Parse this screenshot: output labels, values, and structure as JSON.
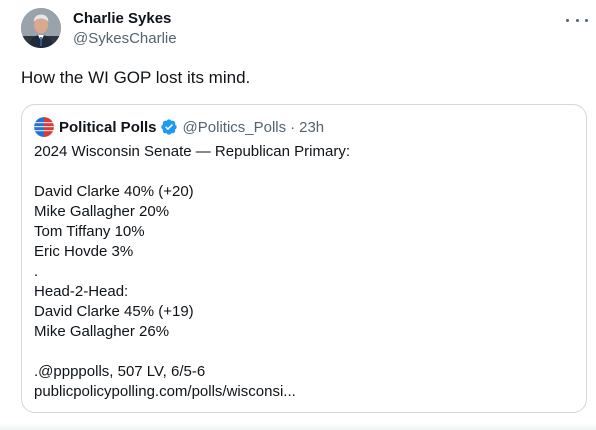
{
  "author": {
    "name": "Charlie Sykes",
    "handle": "@SykesCharlie"
  },
  "tweet": {
    "text": "How the WI GOP lost its mind."
  },
  "quoted": {
    "name": "Political Polls",
    "handle": "@Politics_Polls",
    "separator": "·",
    "time": "23h",
    "lines": [
      "2024 Wisconsin Senate — Republican Primary:",
      "",
      "David Clarke 40% (+20)",
      "Mike Gallagher 20%",
      "Tom Tiffany 10%",
      "Eric Hovde 3%",
      ".",
      "Head-2-Head:",
      "David Clarke 45% (+19)",
      "Mike Gallagher 26%",
      "",
      ".@ppppolls, 507 LV, 6/5-6",
      "publicpolicypolling.com/polls/wisconsi..."
    ]
  },
  "icons": {
    "more": "more-icon",
    "verified": "verified-badge-icon"
  },
  "colors": {
    "text": "#0f1419",
    "secondary": "#536471",
    "border": "#cfd9de",
    "verified": "#1d9bf0"
  }
}
